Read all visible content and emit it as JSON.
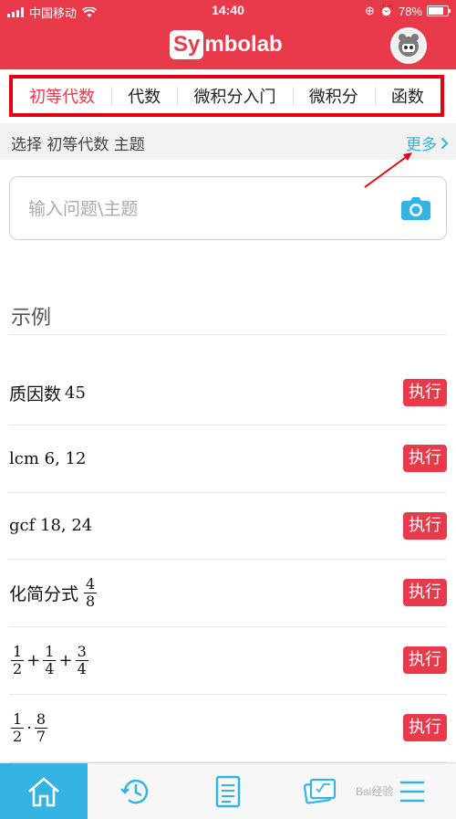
{
  "status_bar": {
    "carrier": "中国移动",
    "time": "14:40",
    "battery": "78%",
    "battery_level": 0.78
  },
  "header": {
    "logo_badge": "Sy",
    "logo_text": "mbolab"
  },
  "tabs": [
    {
      "label": "初等代数",
      "active": true
    },
    {
      "label": "代数",
      "active": false
    },
    {
      "label": "微积分入门",
      "active": false
    },
    {
      "label": "微积分",
      "active": false
    },
    {
      "label": "函数",
      "active": false
    }
  ],
  "topic_bar": {
    "label": "选择 初等代数 主题",
    "more": "更多"
  },
  "search": {
    "placeholder": "输入问题\\主题"
  },
  "examples": {
    "title": "示例",
    "run_label": "执行",
    "rows": [
      {
        "prefix": "质因数",
        "math": "45"
      },
      {
        "prefix": "",
        "math": "lcm 6,  12"
      },
      {
        "prefix": "",
        "math": "gcf 18,  24"
      },
      {
        "prefix": "化简分式",
        "frac": [
          "4",
          "8"
        ]
      },
      {
        "prefix": "",
        "fracs": [
          [
            "1",
            "2"
          ],
          [
            "1",
            "4"
          ],
          [
            "3",
            "4"
          ]
        ],
        "op": "+"
      },
      {
        "prefix": "",
        "fracs": [
          [
            "1",
            "2"
          ],
          [
            "8",
            "7"
          ]
        ],
        "op": "·"
      }
    ]
  },
  "colors": {
    "brand": "#e83a4b",
    "accent": "#35b3e3",
    "annotation": "#e60012"
  },
  "watermark": "Bai经验"
}
